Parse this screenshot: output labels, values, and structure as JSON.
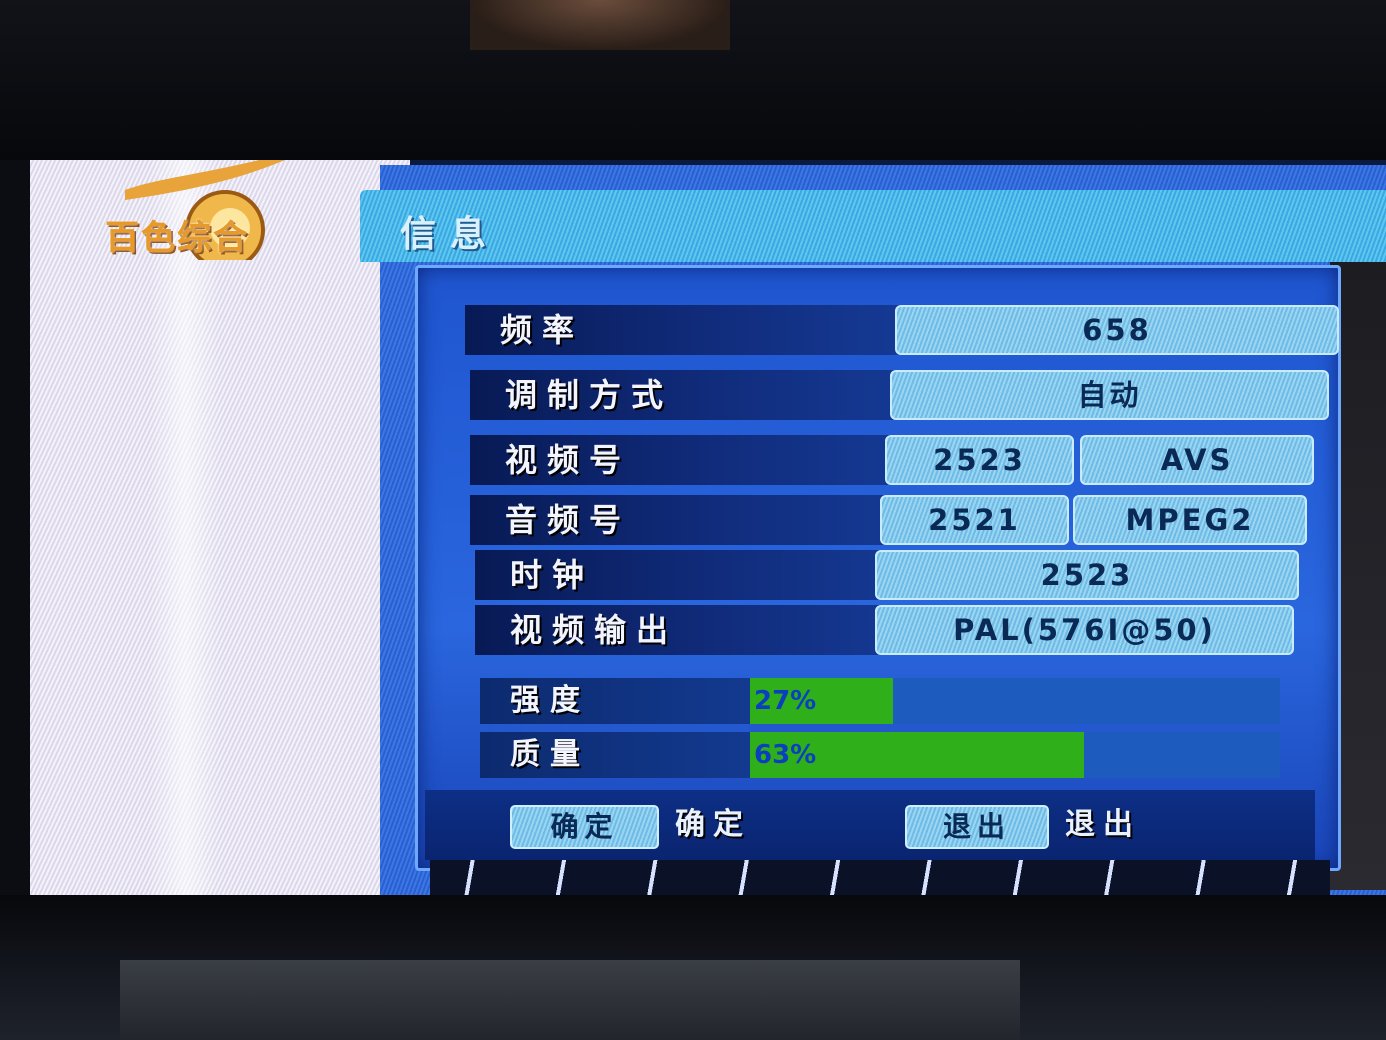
{
  "channel_logo": {
    "text": "百色综合"
  },
  "dialog": {
    "title": "信息"
  },
  "info_rows": [
    {
      "label": "频率",
      "values": [
        "658"
      ]
    },
    {
      "label": "调制方式",
      "values": [
        "自动"
      ]
    },
    {
      "label": "视频号",
      "values": [
        "2523",
        "AVS"
      ]
    },
    {
      "label": "音频号",
      "values": [
        "2521",
        "MPEG2"
      ]
    },
    {
      "label": "时钟",
      "values": [
        "2523"
      ]
    },
    {
      "label": "视频输出",
      "values": [
        "PAL(576I@50)"
      ]
    }
  ],
  "signal": {
    "strength": {
      "label": "强度",
      "value_text": "27%",
      "fraction": 0.27
    },
    "quality": {
      "label": "质量",
      "value_text": "63%",
      "fraction": 0.63
    }
  },
  "footer": {
    "ok_button": "确定",
    "ok_caption": "确定",
    "exit_button": "退出",
    "exit_caption": "退出"
  },
  "colors": {
    "bar_fill": "#2fb01a",
    "panel": "#1f56d0",
    "title_bar": "#5fc7ef"
  }
}
